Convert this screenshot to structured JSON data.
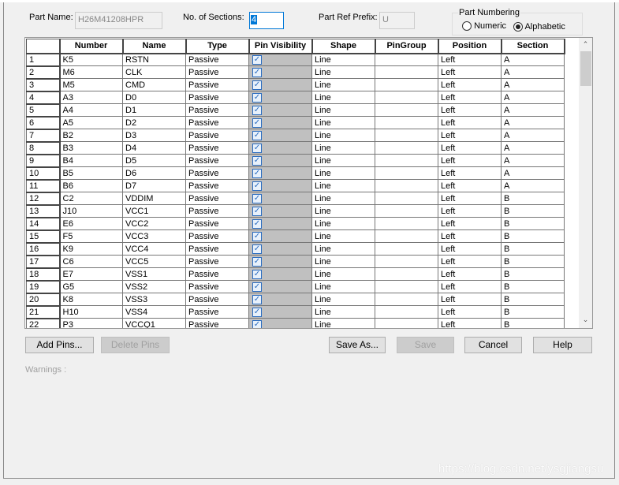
{
  "header": {
    "part_name_label": "Part Name:",
    "part_name_value": "H26M41208HPR",
    "sections_label": "No. of Sections:",
    "sections_value": "4",
    "prefix_label": "Part Ref Prefix:",
    "prefix_value": "U",
    "numbering_label": "Part Numbering",
    "numbering_options": [
      "Numeric",
      "Alphabetic"
    ],
    "numbering_selected": "Alphabetic"
  },
  "table": {
    "columns": [
      "",
      "Number",
      "Name",
      "Type",
      "Pin Visibility",
      "Shape",
      "PinGroup",
      "Position",
      "Section"
    ],
    "rows": [
      [
        "1",
        "K5",
        "RSTN",
        "Passive",
        true,
        "Line",
        "",
        "Left",
        "A"
      ],
      [
        "2",
        "M6",
        "CLK",
        "Passive",
        true,
        "Line",
        "",
        "Left",
        "A"
      ],
      [
        "3",
        "M5",
        "CMD",
        "Passive",
        true,
        "Line",
        "",
        "Left",
        "A"
      ],
      [
        "4",
        "A3",
        "D0",
        "Passive",
        true,
        "Line",
        "",
        "Left",
        "A"
      ],
      [
        "5",
        "A4",
        "D1",
        "Passive",
        true,
        "Line",
        "",
        "Left",
        "A"
      ],
      [
        "6",
        "A5",
        "D2",
        "Passive",
        true,
        "Line",
        "",
        "Left",
        "A"
      ],
      [
        "7",
        "B2",
        "D3",
        "Passive",
        true,
        "Line",
        "",
        "Left",
        "A"
      ],
      [
        "8",
        "B3",
        "D4",
        "Passive",
        true,
        "Line",
        "",
        "Left",
        "A"
      ],
      [
        "9",
        "B4",
        "D5",
        "Passive",
        true,
        "Line",
        "",
        "Left",
        "A"
      ],
      [
        "10",
        "B5",
        "D6",
        "Passive",
        true,
        "Line",
        "",
        "Left",
        "A"
      ],
      [
        "11",
        "B6",
        "D7",
        "Passive",
        true,
        "Line",
        "",
        "Left",
        "A"
      ],
      [
        "12",
        "C2",
        "VDDIM",
        "Passive",
        true,
        "Line",
        "",
        "Left",
        "B"
      ],
      [
        "13",
        "J10",
        "VCC1",
        "Passive",
        true,
        "Line",
        "",
        "Left",
        "B"
      ],
      [
        "14",
        "E6",
        "VCC2",
        "Passive",
        true,
        "Line",
        "",
        "Left",
        "B"
      ],
      [
        "15",
        "F5",
        "VCC3",
        "Passive",
        true,
        "Line",
        "",
        "Left",
        "B"
      ],
      [
        "16",
        "K9",
        "VCC4",
        "Passive",
        true,
        "Line",
        "",
        "Left",
        "B"
      ],
      [
        "17",
        "C6",
        "VCC5",
        "Passive",
        true,
        "Line",
        "",
        "Left",
        "B"
      ],
      [
        "18",
        "E7",
        "VSS1",
        "Passive",
        true,
        "Line",
        "",
        "Left",
        "B"
      ],
      [
        "19",
        "G5",
        "VSS2",
        "Passive",
        true,
        "Line",
        "",
        "Left",
        "B"
      ],
      [
        "20",
        "K8",
        "VSS3",
        "Passive",
        true,
        "Line",
        "",
        "Left",
        "B"
      ],
      [
        "21",
        "H10",
        "VSS4",
        "Passive",
        true,
        "Line",
        "",
        "Left",
        "B"
      ],
      [
        "22",
        "P3",
        "VCCQ1",
        "Passive",
        true,
        "Line",
        "",
        "Left",
        "B"
      ]
    ]
  },
  "buttons": {
    "add_pins": "Add Pins...",
    "delete_pins": "Delete Pins",
    "save_as": "Save As...",
    "save": "Save",
    "cancel": "Cancel",
    "help": "Help"
  },
  "warnings_label": "Warnings :",
  "watermark": "https://blog.csdn.net/ysgjiangsu"
}
